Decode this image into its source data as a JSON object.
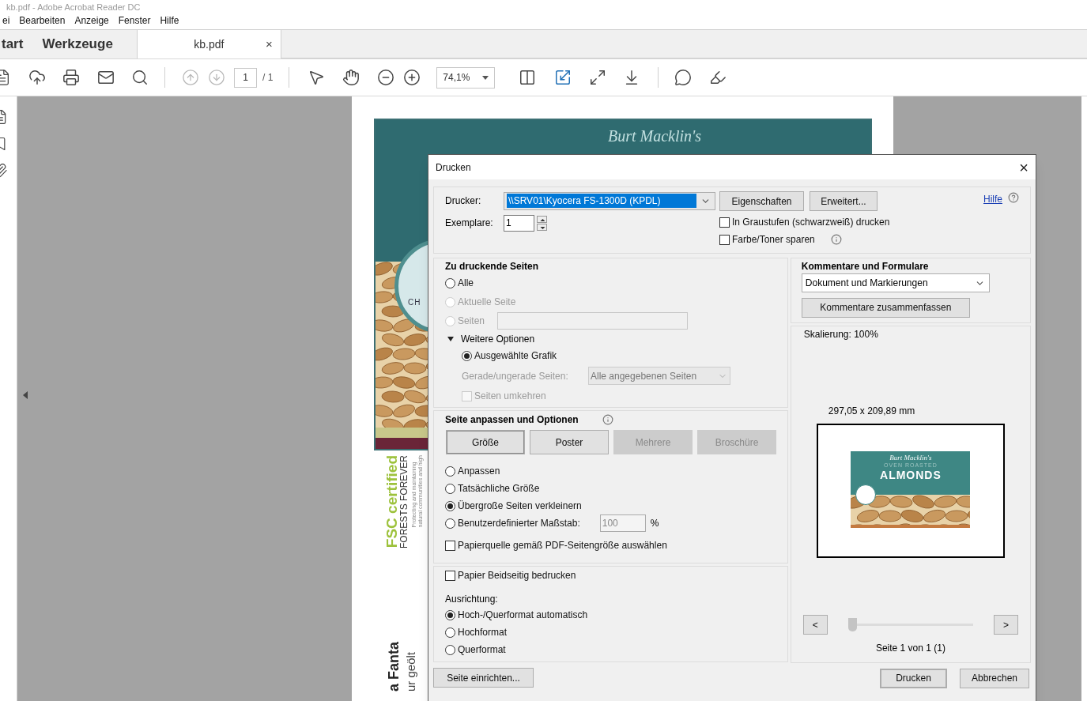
{
  "window": {
    "title": "kb.pdf - Adobe Acrobat Reader DC"
  },
  "menu": [
    "ei",
    "Bearbeiten",
    "Anzeige",
    "Fenster",
    "Hilfe"
  ],
  "tabs": [
    {
      "label": "tart",
      "selected": false,
      "closable": false
    },
    {
      "label": "Werkzeuge",
      "selected": false,
      "closable": false
    },
    {
      "label": "kb.pdf",
      "selected": true,
      "closable": true
    }
  ],
  "tab_close": "×",
  "toolbar": {
    "page": "1",
    "page_total": "/ 1",
    "zoom": "74,1%"
  },
  "document": {
    "brand": "Burt Macklin's",
    "badge": "CH",
    "fsc": "FSC certified",
    "forests": "FORESTS FOREVER",
    "protect": [
      "Protecting and maintaining",
      "natural communities and high"
    ],
    "lines": [
      "a Fanta",
      "ur geölt"
    ]
  },
  "dialog": {
    "title": "Drucken",
    "close": "×",
    "printer": {
      "label": "Drucker:",
      "value": "\\\\SRV01\\Kyocera FS-1300D (KPDL)"
    },
    "buttons_top": [
      "Eigenschaften",
      "Erweitert..."
    ],
    "help": "Hilfe",
    "copies": {
      "label": "Exemplare:",
      "value": "1"
    },
    "options": [
      {
        "label": "In Graustufen (schwarzweiß) drucken",
        "checked": false,
        "info": false
      },
      {
        "label": "Farbe/Toner sparen",
        "checked": false,
        "info": true
      }
    ],
    "pages": {
      "title": "Zu druckende Seiten",
      "choices": [
        {
          "label": "Alle",
          "selected": false,
          "disabled": false,
          "field": false
        },
        {
          "label": "Aktuelle Seite",
          "selected": false,
          "disabled": true,
          "field": false
        },
        {
          "label": "Seiten",
          "selected": false,
          "disabled": true,
          "field": true
        }
      ],
      "more": {
        "label": "Weitere Optionen",
        "expanded": true,
        "choice": {
          "label": "Ausgewählte Grafik",
          "selected": true
        },
        "parity": {
          "label": "Gerade/ungerade Seiten:",
          "value": "Alle angegebenen Seiten",
          "disabled": true
        },
        "reverse": {
          "label": "Seiten umkehren",
          "checked": false,
          "disabled": true
        }
      }
    },
    "sizing": {
      "title": "Seite anpassen und Optionen",
      "modes": [
        {
          "label": "Größe",
          "selected": true,
          "disabled": false
        },
        {
          "label": "Poster",
          "selected": false,
          "disabled": false
        },
        {
          "label": "Mehrere",
          "selected": false,
          "disabled": true
        },
        {
          "label": "Broschüre",
          "selected": false,
          "disabled": true
        }
      ],
      "choices": [
        {
          "label": "Anpassen",
          "selected": false
        },
        {
          "label": "Tatsächliche Größe",
          "selected": false
        },
        {
          "label": "Übergroße Seiten verkleinern",
          "selected": true
        },
        {
          "label": "Benutzerdefinierter Maßstab:",
          "selected": false,
          "value": "100",
          "unit": "%"
        }
      ],
      "paper_source": {
        "label": "Papierquelle gemäß PDF-Seitengröße auswählen",
        "checked": false
      }
    },
    "duplex": {
      "label": "Papier Beidseitig bedrucken",
      "checked": false
    },
    "orientation": {
      "label": "Ausrichtung:",
      "choices": [
        {
          "label": "Hoch-/Querformat automatisch",
          "selected": true
        },
        {
          "label": "Hochformat",
          "selected": false
        },
        {
          "label": "Querformat",
          "selected": false
        }
      ]
    },
    "comments": {
      "title": "Kommentare und Formulare",
      "value": "Dokument und Markierungen",
      "button": "Kommentare zusammenfassen"
    },
    "preview": {
      "scaling": "Skalierung: 100%",
      "size": "297,05 x 209,89 mm",
      "brand": "Burt Macklin's",
      "subtitle": "OVEN ROASTED",
      "product": "ALMONDS",
      "prev": "<",
      "next": ">",
      "level": 0,
      "page": "Seite 1 von 1 (1)"
    },
    "setup": "Seite einrichten...",
    "actions": [
      {
        "label": "Drucken",
        "default": true
      },
      {
        "label": "Abbrechen",
        "default": false
      }
    ]
  }
}
